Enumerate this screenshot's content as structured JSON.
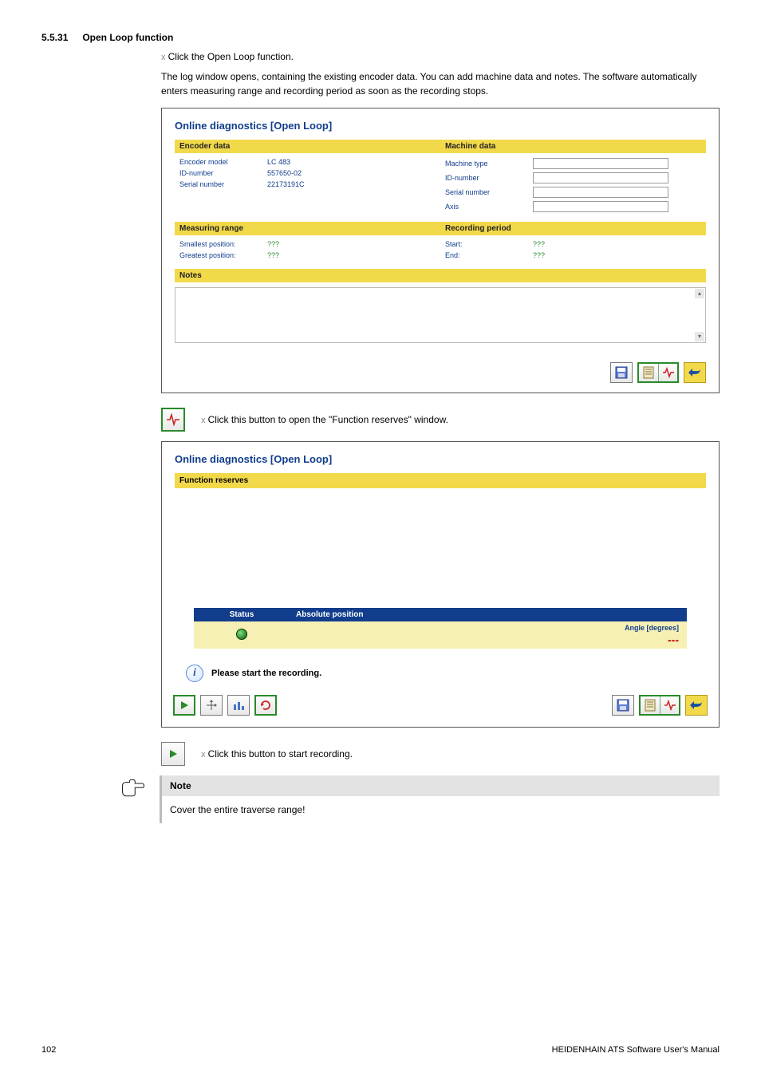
{
  "section_number": "5.5.31",
  "section_title": "Open Loop function",
  "intro_bullet": "Click the Open Loop function.",
  "intro_para": "The log window opens, containing the existing encoder data. You can add machine data and notes. The software automatically enters measuring range and recording period as soon as the recording stops.",
  "screenshot1": {
    "title": "Online diagnostics [Open Loop]",
    "encoder_data_header": "Encoder data",
    "machine_data_header": "Machine data",
    "encoder_model_label": "Encoder model",
    "encoder_model_value": "LC 483",
    "id_number_label": "ID-number",
    "id_number_value": "557650-02",
    "serial_number_label": "Serial number",
    "serial_number_value": "22173191C",
    "machine_type_label": "Machine type",
    "machine_id_label": "ID-number",
    "machine_serial_label": "Serial number",
    "axis_label": "Axis",
    "measuring_range_header": "Measuring range",
    "recording_period_header": "Recording period",
    "smallest_position_label": "Smallest position:",
    "greatest_position_label": "Greatest position:",
    "start_label": "Start:",
    "end_label": "End:",
    "qmark": "???",
    "notes_header": "Notes"
  },
  "mid_caption": "Click this button to open the \"Function reserves\" window.",
  "screenshot2": {
    "title": "Online diagnostics [Open Loop]",
    "function_reserves_header": "Function reserves",
    "status_col": "Status",
    "abs_pos_col": "Absolute position",
    "angle_label": "Angle [degrees]",
    "angle_value": "---",
    "info_text": "Please start the recording."
  },
  "play_caption": "Click this button to start recording.",
  "note_heading": "Note",
  "note_body": "Cover the entire traverse range!",
  "footer_page": "102",
  "footer_right": "HEIDENHAIN ATS Software User's Manual"
}
